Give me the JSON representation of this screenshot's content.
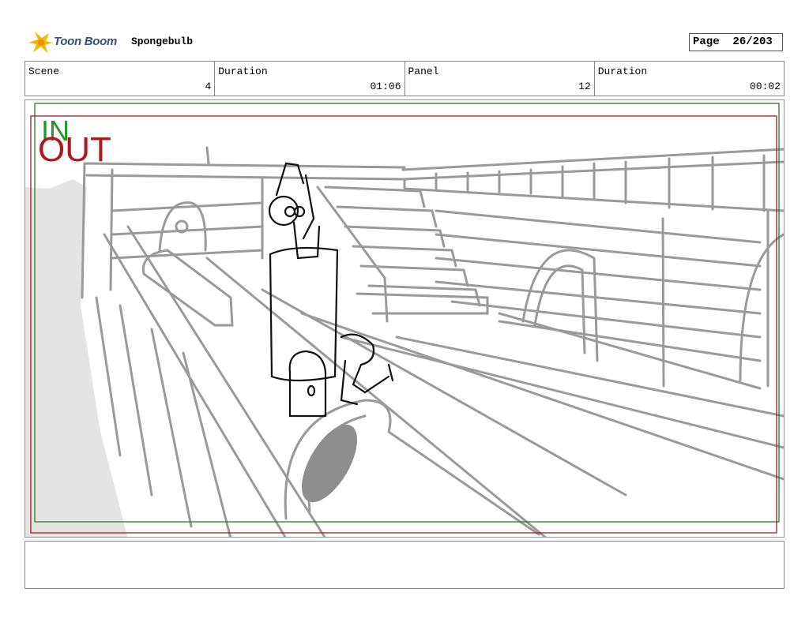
{
  "header": {
    "logo_text": "Toon Boom",
    "project_name": "Spongebulb",
    "page_label": "Page",
    "page_value": "26/203"
  },
  "info": {
    "scene_label": "Scene",
    "scene_value": "4",
    "scene_duration_label": "Duration",
    "scene_duration_value": "01:06",
    "panel_label": "Panel",
    "panel_value": "12",
    "panel_duration_label": "Duration",
    "panel_duration_value": "00:02"
  },
  "panel": {
    "in_label": "IN",
    "out_label": "OUT",
    "in_color": "#1e9a2a",
    "out_color": "#b01820"
  },
  "notes": {
    "text": ""
  }
}
